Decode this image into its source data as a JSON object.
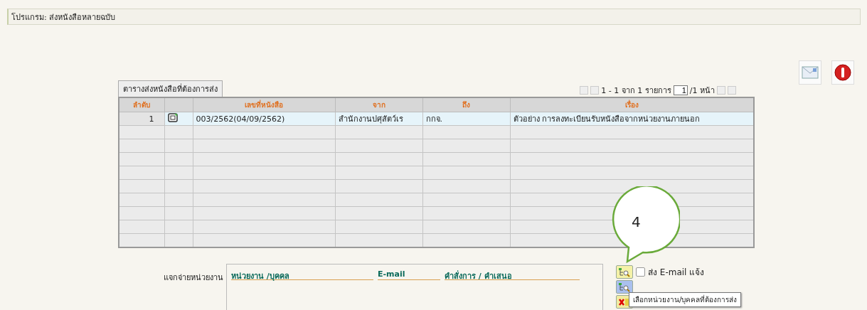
{
  "program_title": "โปรแกรม: ส่งหนังสือหลายฉบับ",
  "toolbar": [
    {
      "kind": "envelope"
    },
    {
      "kind": "exit"
    }
  ],
  "table": {
    "tab": "ตารางส่งหนังสือที่ต้องการส่ง",
    "pager": {
      "summary": "1 - 1 จาก 1 รายการ",
      "page": "1",
      "total": "/1 หน้า"
    },
    "columns": [
      "ลำดับ",
      "",
      "เลขที่หนังสือ",
      "จาก",
      "ถึง",
      "เรื่อง"
    ],
    "rows": [
      {
        "no": "1",
        "number": "003/2562(04/09/2562)",
        "from": "สำนักงานปศุสัตว์เร",
        "to": "กกจ.",
        "subject": "ตัวอย่าง การลงทะเบียนรับหนังสือจากหน่วยงานภายนอก"
      }
    ]
  },
  "distribution": {
    "label": "แจกจ่ายหน่วยงาน",
    "columns": [
      "หน่วยงาน /บุคคล",
      "E-mail",
      "คำสั่งการ / คำเสนอ"
    ],
    "send_email": {
      "label": "ส่ง E-mail แจ้ง",
      "checked": false
    },
    "tooltip": "เลือกหน่วยงาน/บุคคลที่ต้องการส่ง"
  },
  "callout": "4"
}
